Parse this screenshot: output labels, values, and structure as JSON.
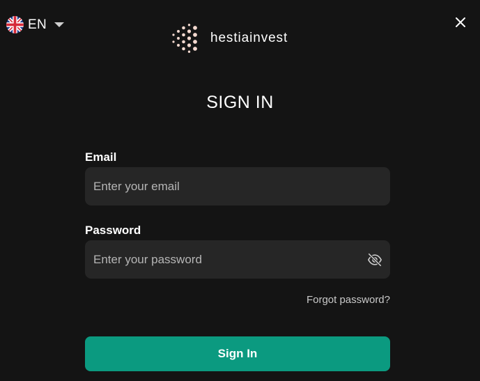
{
  "language": {
    "code": "EN",
    "flag_icon": "uk-flag-icon"
  },
  "brand": {
    "name": "hestiainvest",
    "icon": "honeycomb-dots-logo"
  },
  "close_icon": "close-icon",
  "form": {
    "title": "SIGN IN",
    "email": {
      "label": "Email",
      "value": "",
      "placeholder": "Enter your email"
    },
    "password": {
      "label": "Password",
      "value": "",
      "placeholder": "Enter your password",
      "visibility_icon": "eye-off-icon"
    },
    "forgot_password_label": "Forgot password?",
    "submit_label": "Sign In"
  },
  "colors": {
    "background": "#141414",
    "input_background": "#262626",
    "primary_button": "#0b9a80",
    "logo_dots": "#f4d9cf"
  }
}
